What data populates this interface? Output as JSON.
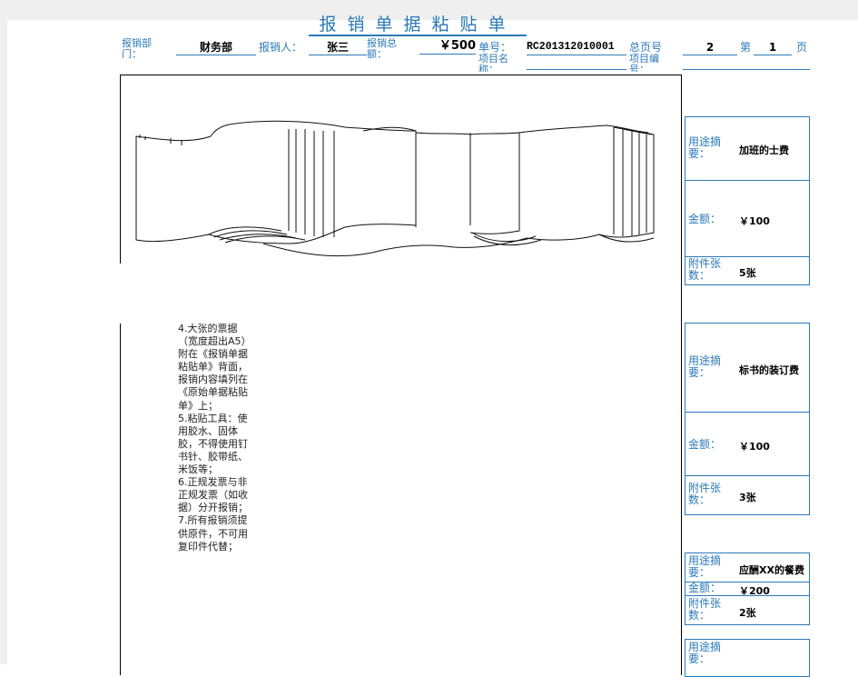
{
  "title": "报销单据粘贴单",
  "header": {
    "dept_label": "报销部门：",
    "dept_value": "财务部",
    "claimant_label": "报销人：",
    "claimant_value": "张三",
    "total_label": "报销总额：",
    "total_value": "￥500",
    "doc_no_label": "单号：",
    "doc_no_value": "RC201312010001",
    "project_label": "项目名称：",
    "total_pages_label": "总页号",
    "total_pages_value": "2",
    "project_no_label": "项目编号：",
    "page_prefix": "第",
    "page_value": "1",
    "page_suffix": "页"
  },
  "notes": [
    "4.大张的票据（宽度超出A5）附在《报销单据粘贴单》背面，报销内容填列在《原始单据粘贴单》上；",
    "5.粘贴工具：使用胶水、固体胶，不得使用钉书针、胶带纸、米饭等；",
    "6.正规发票与非正规发票（如收据）分开报销；",
    "7.所有报销须提供原件，不可用复印件代替；"
  ],
  "cards": [
    {
      "purpose_label": "用途摘要：",
      "purpose": "加班的士费",
      "amount_label": "金额：",
      "amount": "￥100",
      "count_label": "附件张数：",
      "count": "5张"
    },
    {
      "purpose_label": "用途摘要：",
      "purpose": "标书的装订费",
      "amount_label": "金额：",
      "amount": "￥100",
      "count_label": "附件张数：",
      "count": "3张"
    },
    {
      "purpose_label": "用途摘要：",
      "purpose": "应酬XX的餐费",
      "amount_label": "金额：",
      "amount": "￥200",
      "count_label": "附件张数：",
      "count": "2张"
    },
    {
      "purpose_label": "用途摘要："
    }
  ]
}
